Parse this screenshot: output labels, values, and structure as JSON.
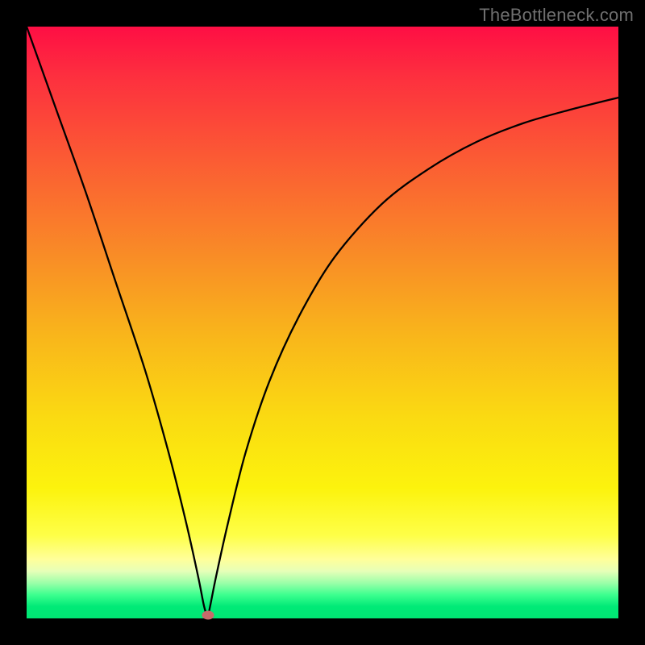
{
  "watermark": "TheBottleneck.com",
  "chart_data": {
    "type": "line",
    "title": "",
    "xlabel": "",
    "ylabel": "",
    "xlim": [
      0,
      100
    ],
    "ylim": [
      0,
      100
    ],
    "grid": false,
    "legend": false,
    "background_gradient": {
      "top_color": "#fe0e44",
      "bottom_color": "#00e673",
      "description": "red-to-green vertical gradient indicating bottleneck severity (top=high, bottom=none)"
    },
    "series": [
      {
        "name": "bottleneck_curve",
        "color": "#000000",
        "x": [
          0,
          5,
          10,
          15,
          20,
          24,
          27,
          29,
          30,
          30.6,
          31,
          32,
          34,
          37,
          41,
          46,
          52,
          60,
          68,
          76,
          84,
          92,
          100
        ],
        "y": [
          100,
          86,
          72,
          57,
          42,
          28,
          16,
          7,
          2,
          0.5,
          2,
          7,
          16,
          28,
          40,
          51,
          61,
          70,
          76,
          80.5,
          83.7,
          86,
          88
        ]
      }
    ],
    "marker": {
      "name": "optimal_point",
      "x": 30.6,
      "y": 0.5,
      "color": "#c76a6a"
    }
  }
}
